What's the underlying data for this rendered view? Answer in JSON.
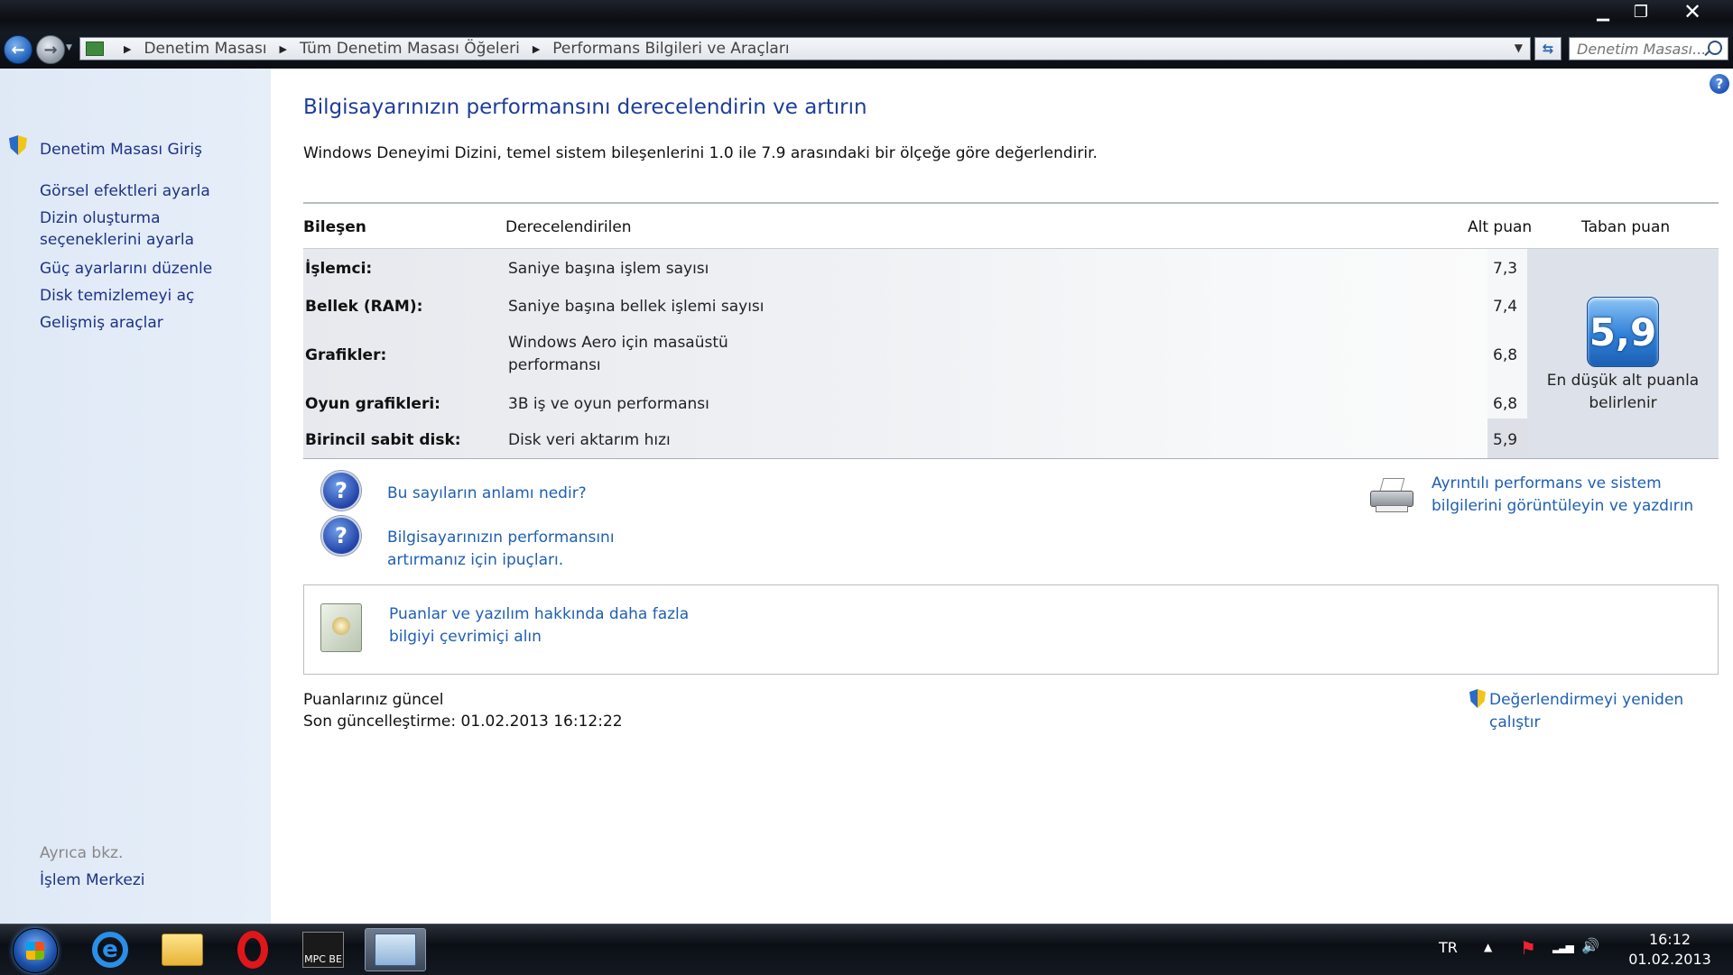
{
  "window": {
    "minimize": "▁",
    "maximize": "❐",
    "close": "✕"
  },
  "nav": {
    "back_glyph": "←",
    "forward_glyph": "→",
    "breadcrumb": [
      "Denetim Masası",
      "Tüm Denetim Masası Öğeleri",
      "Performans Bilgileri ve Araçları"
    ],
    "breadcrumb_sep": "▶",
    "dropdown_glyph": "▼",
    "refresh_glyph": "⇆",
    "search_placeholder": "Denetim Masası..."
  },
  "sidebar": {
    "home": "Denetim Masası Giriş",
    "items": [
      "Görsel efektleri ayarla",
      "Dizin oluşturma seçeneklerini ayarla",
      "Güç ayarlarını düzenle",
      "Disk temizlemeyi aç",
      "Gelişmiş araçlar"
    ],
    "see_also": "Ayrıca bkz.",
    "action_center": "İşlem Merkezi"
  },
  "main": {
    "help_glyph": "?",
    "title": "Bilgisayarınızın performansını derecelendirin ve artırın",
    "description": "Windows Deneyimi Dizini, temel sistem bileşenlerini 1.0 ile 7.9 arasındaki bir ölçeğe göre değerlendirir.",
    "table": {
      "headers": {
        "component": "Bileşen",
        "rated": "Derecelendirilen",
        "subscore": "Alt puan",
        "basescore": "Taban puan"
      },
      "rows": [
        {
          "label": "İşlemci:",
          "desc": "Saniye başına işlem sayısı",
          "score": "7,3"
        },
        {
          "label": "Bellek (RAM):",
          "desc": "Saniye başına bellek işlemi sayısı",
          "score": "7,4"
        },
        {
          "label": "Grafikler:",
          "desc": "Windows Aero için masaüstü performansı",
          "score": "6,8"
        },
        {
          "label": "Oyun grafikleri:",
          "desc": "3B iş ve oyun performansı",
          "score": "6,8"
        },
        {
          "label": "Birincil sabit disk:",
          "desc": "Disk veri aktarım hızı",
          "score": "5,9"
        }
      ],
      "base_score": "5,9",
      "base_caption": "En düşük alt puanla belirlenir"
    },
    "links": {
      "meaning": "Bu sayıların anlamı nedir?",
      "tips": "Bilgisayarınızın performansını artırmanız için ipuçları.",
      "details": "Ayrıntılı performans ve sistem bilgilerini görüntüleyin ve yazdırın",
      "online": "Puanlar ve yazılım hakkında daha fazla bilgiyi çevrimiçi alın",
      "rerun": "Değerlendirmeyi yeniden çalıştır"
    },
    "status": {
      "current": "Puanlarınız güncel",
      "last_update": "Son güncelleştirme: 01.02.2013 16:12:22"
    }
  },
  "taskbar": {
    "ie_glyph": "e",
    "mpc_label": "MPC BE",
    "language": "TR",
    "tray_expand": "▲",
    "flag_glyph": "⚑",
    "network_glyph": "▂▃▅",
    "volume_glyph": "🔊",
    "time": "16:12",
    "date": "01.02.2013"
  }
}
